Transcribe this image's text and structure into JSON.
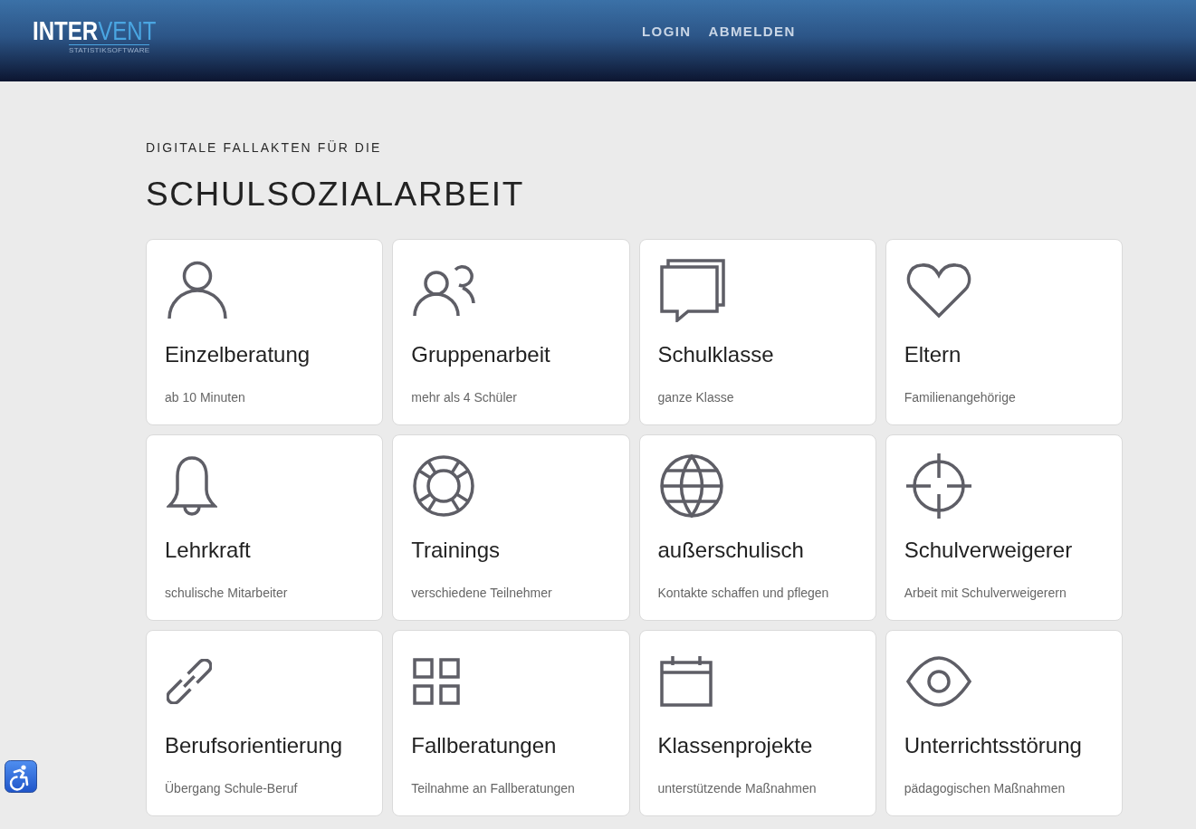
{
  "header": {
    "logo": {
      "primary": "INTER",
      "accent": "VENT",
      "tagline": "STATISTIKSOFTWARE"
    },
    "nav": [
      "LOGIN",
      "ABMELDEN"
    ]
  },
  "intro": {
    "eyebrow": "DIGITALE FALLAKTEN FÜR DIE",
    "title": "SCHULSOZIALARBEIT"
  },
  "cards": [
    {
      "kind": "person",
      "title": "Einzelberatung",
      "subtitle": "ab 10 Minuten"
    },
    {
      "kind": "group",
      "title": "Gruppenarbeit",
      "subtitle": "mehr als 4 Schüler"
    },
    {
      "kind": "chat",
      "title": "Schulklasse",
      "subtitle": "ganze Klasse"
    },
    {
      "kind": "heart",
      "title": "Eltern",
      "subtitle": "Familienangehörige"
    },
    {
      "kind": "bell",
      "title": "Lehrkraft",
      "subtitle": "schulische Mitarbeiter"
    },
    {
      "kind": "lifebuoy",
      "title": "Trainings",
      "subtitle": "verschiedene Teilnehmer"
    },
    {
      "kind": "globe",
      "title": "außerschulisch",
      "subtitle": "Kontakte schaffen und pflegen"
    },
    {
      "kind": "crosshair",
      "title": "Schulverweigerer",
      "subtitle": "Arbeit mit Schulverweigerern"
    },
    {
      "kind": "link",
      "title": "Berufsorientierung",
      "subtitle": "Übergang Schule-Beruf"
    },
    {
      "kind": "grid",
      "title": "Fallberatungen",
      "subtitle": "Teilnahme an Fallberatungen"
    },
    {
      "kind": "calendar",
      "title": "Klassenprojekte",
      "subtitle": "unterstützende Maßnahmen"
    },
    {
      "kind": "eye",
      "title": "Unterrichtsstörung",
      "subtitle": "pädagogischen Maßnahmen"
    }
  ]
}
